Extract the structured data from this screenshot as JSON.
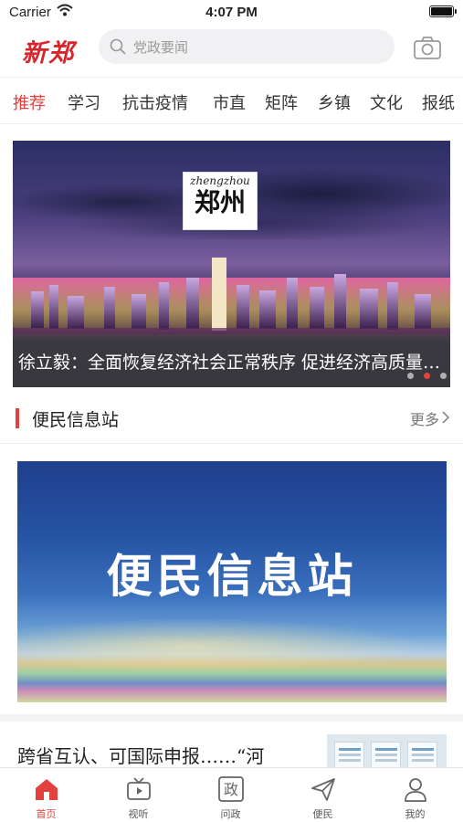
{
  "status_bar": {
    "carrier": "Carrier",
    "time": "4:07 PM"
  },
  "header": {
    "logo": "新郑",
    "search_placeholder": "党政要闻",
    "accent_color": "#e2413d"
  },
  "tabs": [
    {
      "label": "推荐",
      "active": true
    },
    {
      "label": "学习",
      "active": false
    },
    {
      "label": "抗击疫情",
      "active": false
    },
    {
      "label": "市直",
      "active": false
    },
    {
      "label": "矩阵",
      "active": false
    },
    {
      "label": "乡镇",
      "active": false
    },
    {
      "label": "文化",
      "active": false
    },
    {
      "label": "报纸",
      "active": false
    }
  ],
  "banner": {
    "badge_pinyin": "zhengzhou",
    "badge_text": "郑州",
    "caption": "徐立毅：全面恢复经济社会正常秩序 促进经济高质量发展",
    "slide_count": 3,
    "active_slide": 2
  },
  "section": {
    "title": "便民信息站",
    "more_label": "更多"
  },
  "feature": {
    "title": "便民信息站"
  },
  "news": [
    {
      "title": "跨省互认、可国际申报……“河"
    }
  ],
  "bottom_nav": [
    {
      "label": "首页",
      "icon": "home-icon",
      "active": true
    },
    {
      "label": "视听",
      "icon": "tv-icon",
      "active": false
    },
    {
      "label": "问政",
      "icon": "zheng-icon",
      "active": false
    },
    {
      "label": "便民",
      "icon": "send-icon",
      "active": false
    },
    {
      "label": "我的",
      "icon": "user-icon",
      "active": false
    }
  ]
}
